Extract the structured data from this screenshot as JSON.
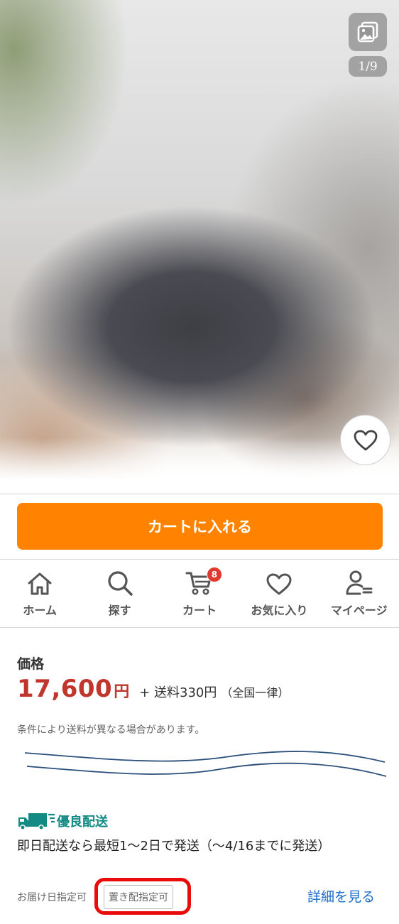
{
  "gallery": {
    "counter": "1/9",
    "icon": "image-gallery-icon"
  },
  "favorite": {
    "icon": "heart-outline-icon"
  },
  "cart_button": {
    "label": "カートに入れる"
  },
  "nav": {
    "items": [
      {
        "label": "ホーム",
        "icon": "home-icon"
      },
      {
        "label": "探す",
        "icon": "search-icon"
      },
      {
        "label": "カート",
        "icon": "cart-icon",
        "badge": "8"
      },
      {
        "label": "お気に入り",
        "icon": "heart-icon"
      },
      {
        "label": "マイページ",
        "icon": "user-icon"
      }
    ]
  },
  "price": {
    "heading": "価格",
    "amount": "17,600",
    "currency": "円",
    "shipping": "+ 送料330円",
    "shipping_note": "（全国一律）",
    "condition_note": "条件により送料が異なる場合があります。"
  },
  "delivery": {
    "badge_label": "優良配送",
    "description": "即日配送なら最短1〜2日で発送（〜4/16までに発送）",
    "date_option": "お届け日指定可",
    "place_option": "置き配指定可",
    "details_link": "詳細を見る"
  },
  "colors": {
    "accent_orange": "#ff8300",
    "price_red": "#c0352c",
    "badge_red": "#e2392f",
    "delivery_teal": "#138a84",
    "link_blue": "#1b6bc9",
    "highlight_red": "#ea0b0b"
  }
}
